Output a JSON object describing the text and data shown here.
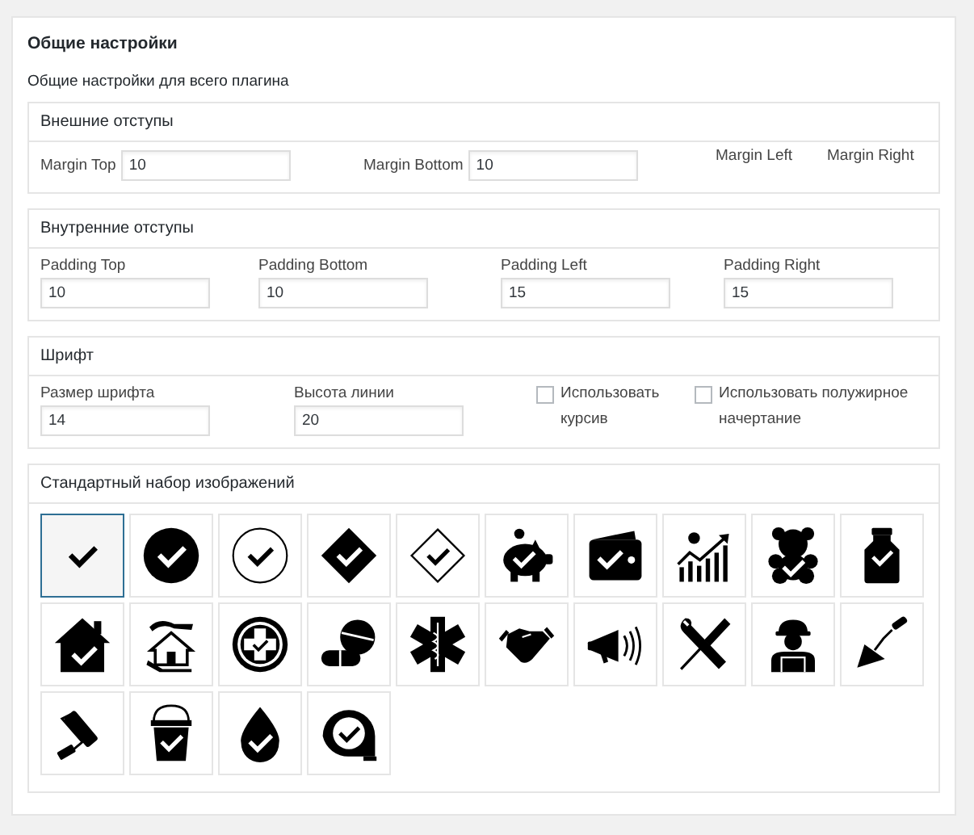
{
  "panel": {
    "title": "Общие настройки",
    "description": "Общие настройки для всего плагина"
  },
  "sections": [
    {
      "title": "Внешние отступы",
      "kind": "margin",
      "fields": [
        {
          "kind": "inline",
          "label": "Margin Top",
          "value": "10"
        },
        {
          "kind": "inline",
          "label": "Margin Bottom",
          "value": "10"
        },
        {
          "kind": "label",
          "label": "Margin Left"
        },
        {
          "kind": "label",
          "label": "Margin Right"
        }
      ]
    },
    {
      "title": "Внутренние отступы",
      "kind": "padding",
      "fields": [
        {
          "kind": "stacked",
          "label": "Padding Top",
          "value": "10"
        },
        {
          "kind": "stacked",
          "label": "Padding Bottom",
          "value": "10"
        },
        {
          "kind": "stacked",
          "label": "Padding Left",
          "value": "15"
        },
        {
          "kind": "stacked",
          "label": "Padding Right",
          "value": "15"
        }
      ]
    },
    {
      "title": "Шрифт",
      "kind": "font",
      "fields": [
        {
          "kind": "stacked",
          "label": "Размер шрифта",
          "value": "14"
        },
        {
          "kind": "stacked",
          "label": "Высота линии",
          "value": "20"
        },
        {
          "kind": "checkbox",
          "label": "Использовать курсив",
          "checked": false
        },
        {
          "kind": "checkbox",
          "label": "Использовать полужирное начертание",
          "checked": false
        }
      ]
    }
  ],
  "images": {
    "title": "Стандартный набор изображений",
    "icons": [
      {
        "selected": true
      },
      {
        "selected": false
      },
      {
        "selected": false
      },
      {
        "selected": false
      },
      {
        "selected": false
      },
      {
        "selected": false
      },
      {
        "selected": false
      },
      {
        "selected": false
      },
      {
        "selected": false
      },
      {
        "selected": false
      },
      {
        "selected": false
      },
      {
        "selected": false
      },
      {
        "selected": false
      },
      {
        "selected": false
      },
      {
        "selected": false
      },
      {
        "selected": false
      },
      {
        "selected": false
      },
      {
        "selected": false
      },
      {
        "selected": false
      },
      {
        "selected": false
      },
      {
        "selected": false
      },
      {
        "selected": false
      },
      {
        "selected": false
      },
      {
        "selected": false
      }
    ]
  }
}
